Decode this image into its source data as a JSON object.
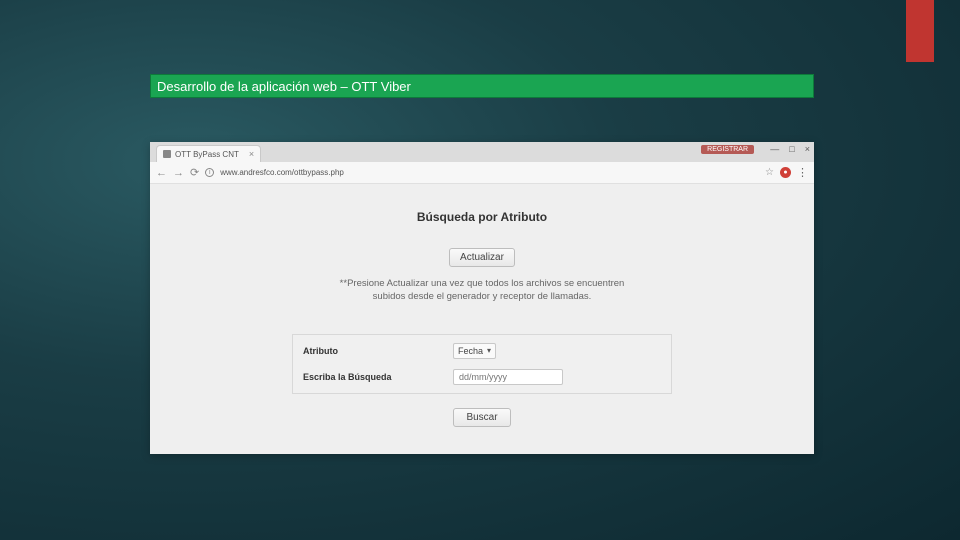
{
  "slide": {
    "title": "Desarrollo de la aplicación web – OTT Viber"
  },
  "browser": {
    "tab_title": "OTT ByPass CNT",
    "url": "www.andresfco.com/ottbypass.php",
    "reg_label": "REGISTRAR"
  },
  "page": {
    "heading": "Búsqueda por Atributo",
    "update_button": "Actualizar",
    "help_text": "**Presione Actualizar una vez que todos los archivos se encuentren subidos desde el generador y receptor de llamadas.",
    "attribute_label": "Atributo",
    "attribute_value": "Fecha",
    "search_label": "Escriba la Búsqueda",
    "search_placeholder": "dd/mm/yyyy",
    "search_button": "Buscar"
  }
}
